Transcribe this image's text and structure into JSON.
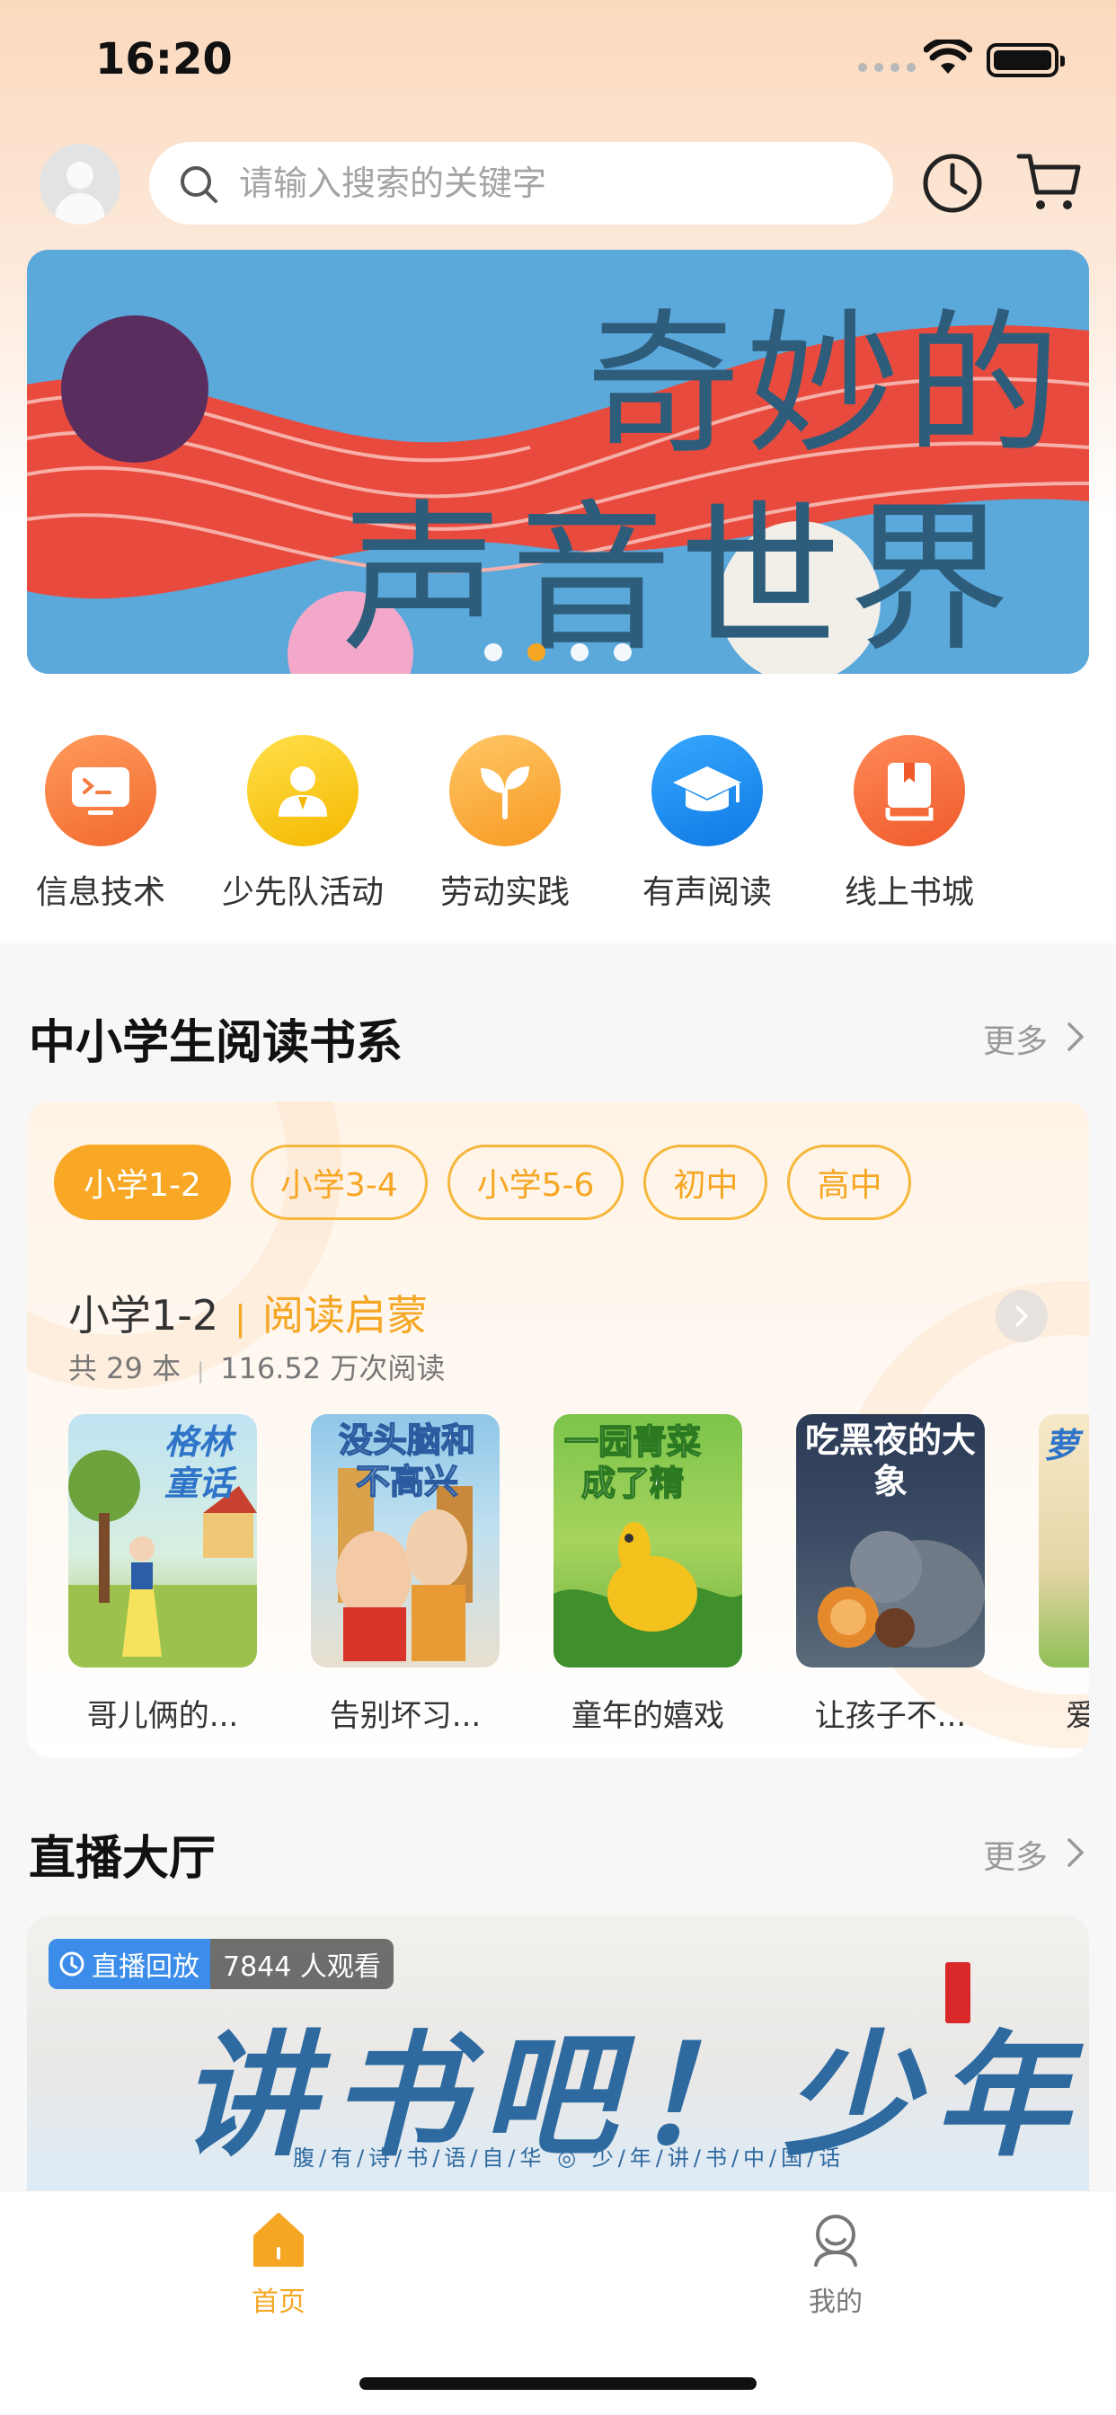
{
  "status_bar": {
    "time": "16:20"
  },
  "header": {
    "search_placeholder": "请输入搜索的关键字"
  },
  "banner": {
    "line1": "奇妙的",
    "line2": "声音世界",
    "active_dot": 1,
    "dot_count": 4
  },
  "categories": [
    {
      "label": "信息技术",
      "icon": "terminal-icon",
      "color": "#f47a3e"
    },
    {
      "label": "少先队活动",
      "icon": "person-icon",
      "color": "#f7c21d"
    },
    {
      "label": "劳动实践",
      "icon": "sprout-icon",
      "color": "#f9a33a"
    },
    {
      "label": "有声阅读",
      "icon": "graduation-cap-icon",
      "color": "#1f8ff0"
    },
    {
      "label": "线上书城",
      "icon": "book-icon",
      "color": "#f46a3a"
    }
  ],
  "reading_section": {
    "title": "中小学生阅读书系",
    "more": "更多",
    "tabs": [
      "小学1-2",
      "小学3-4",
      "小学5-6",
      "初中",
      "高中"
    ],
    "active_tab": 0,
    "series_grade": "小学1-2",
    "series_name": "阅读启蒙",
    "book_count": "共 29 本",
    "read_count": "116.52 万次阅读",
    "books": [
      {
        "name": "哥儿俩的...",
        "cover_title": "格林童话"
      },
      {
        "name": "告别坏习...",
        "cover_title": "没头脑和不高兴"
      },
      {
        "name": "童年的嬉戏",
        "cover_title": "一园青菜成了精"
      },
      {
        "name": "让孩子不...",
        "cover_title": "吃黑夜的大象"
      },
      {
        "name": "爱",
        "cover_title": "萝"
      }
    ]
  },
  "live_section": {
    "title": "直播大厅",
    "more": "更多",
    "badge": "直播回放",
    "views": "7844 人观看",
    "poster_title": "讲书吧！少年",
    "poster_subtitle": "腹/有/诗/书/语/自/华 ◎ 少/年/讲/书/中/国/话"
  },
  "tab_bar": {
    "items": [
      {
        "label": "首页",
        "active": true
      },
      {
        "label": "我的",
        "active": false
      }
    ],
    "active_color": "#f5a623",
    "inactive_color": "#777777"
  }
}
